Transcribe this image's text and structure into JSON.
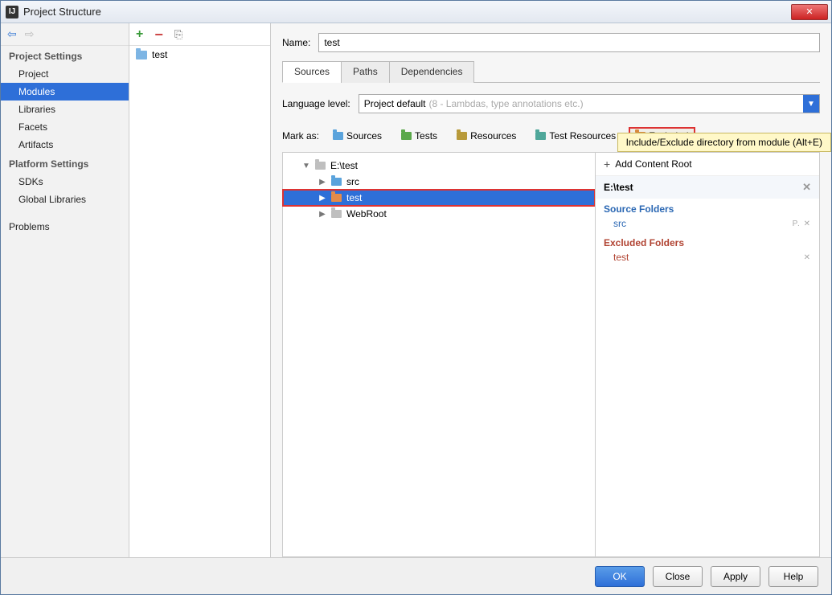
{
  "window": {
    "title": "Project Structure",
    "close_text": "✕"
  },
  "sidebar": {
    "sections": [
      {
        "title": "Project Settings",
        "items": [
          "Project",
          "Modules",
          "Libraries",
          "Facets",
          "Artifacts"
        ],
        "selected_index": 1
      },
      {
        "title": "Platform Settings",
        "items": [
          "SDKs",
          "Global Libraries"
        ]
      }
    ],
    "extra_item": "Problems"
  },
  "module_list": {
    "items": [
      "test"
    ]
  },
  "form": {
    "name_label": "Name:",
    "name_value": "test",
    "tabs": [
      "Sources",
      "Paths",
      "Dependencies"
    ],
    "active_tab_index": 0,
    "lang_label": "Language level:",
    "lang_value": "Project default",
    "lang_hint": "(8 - Lambdas, type annotations etc.)",
    "tooltip": "Include/Exclude directory from module (Alt+E)",
    "mark_label": "Mark as:",
    "mark_buttons": [
      "Sources",
      "Tests",
      "Resources",
      "Test Resources",
      "Excluded"
    ]
  },
  "tree": {
    "root": "E:\\test",
    "children": [
      {
        "name": "src",
        "kind": "blue"
      },
      {
        "name": "test",
        "kind": "orange",
        "selected": true
      },
      {
        "name": "WebRoot",
        "kind": "grey"
      }
    ]
  },
  "right_panel": {
    "add_label": "Add Content Root",
    "root": "E:\\test",
    "source_title": "Source Folders",
    "source_items": [
      "src"
    ],
    "excluded_title": "Excluded Folders",
    "excluded_items": [
      "test"
    ]
  },
  "footer": {
    "ok": "OK",
    "close": "Close",
    "apply": "Apply",
    "help": "Help"
  }
}
